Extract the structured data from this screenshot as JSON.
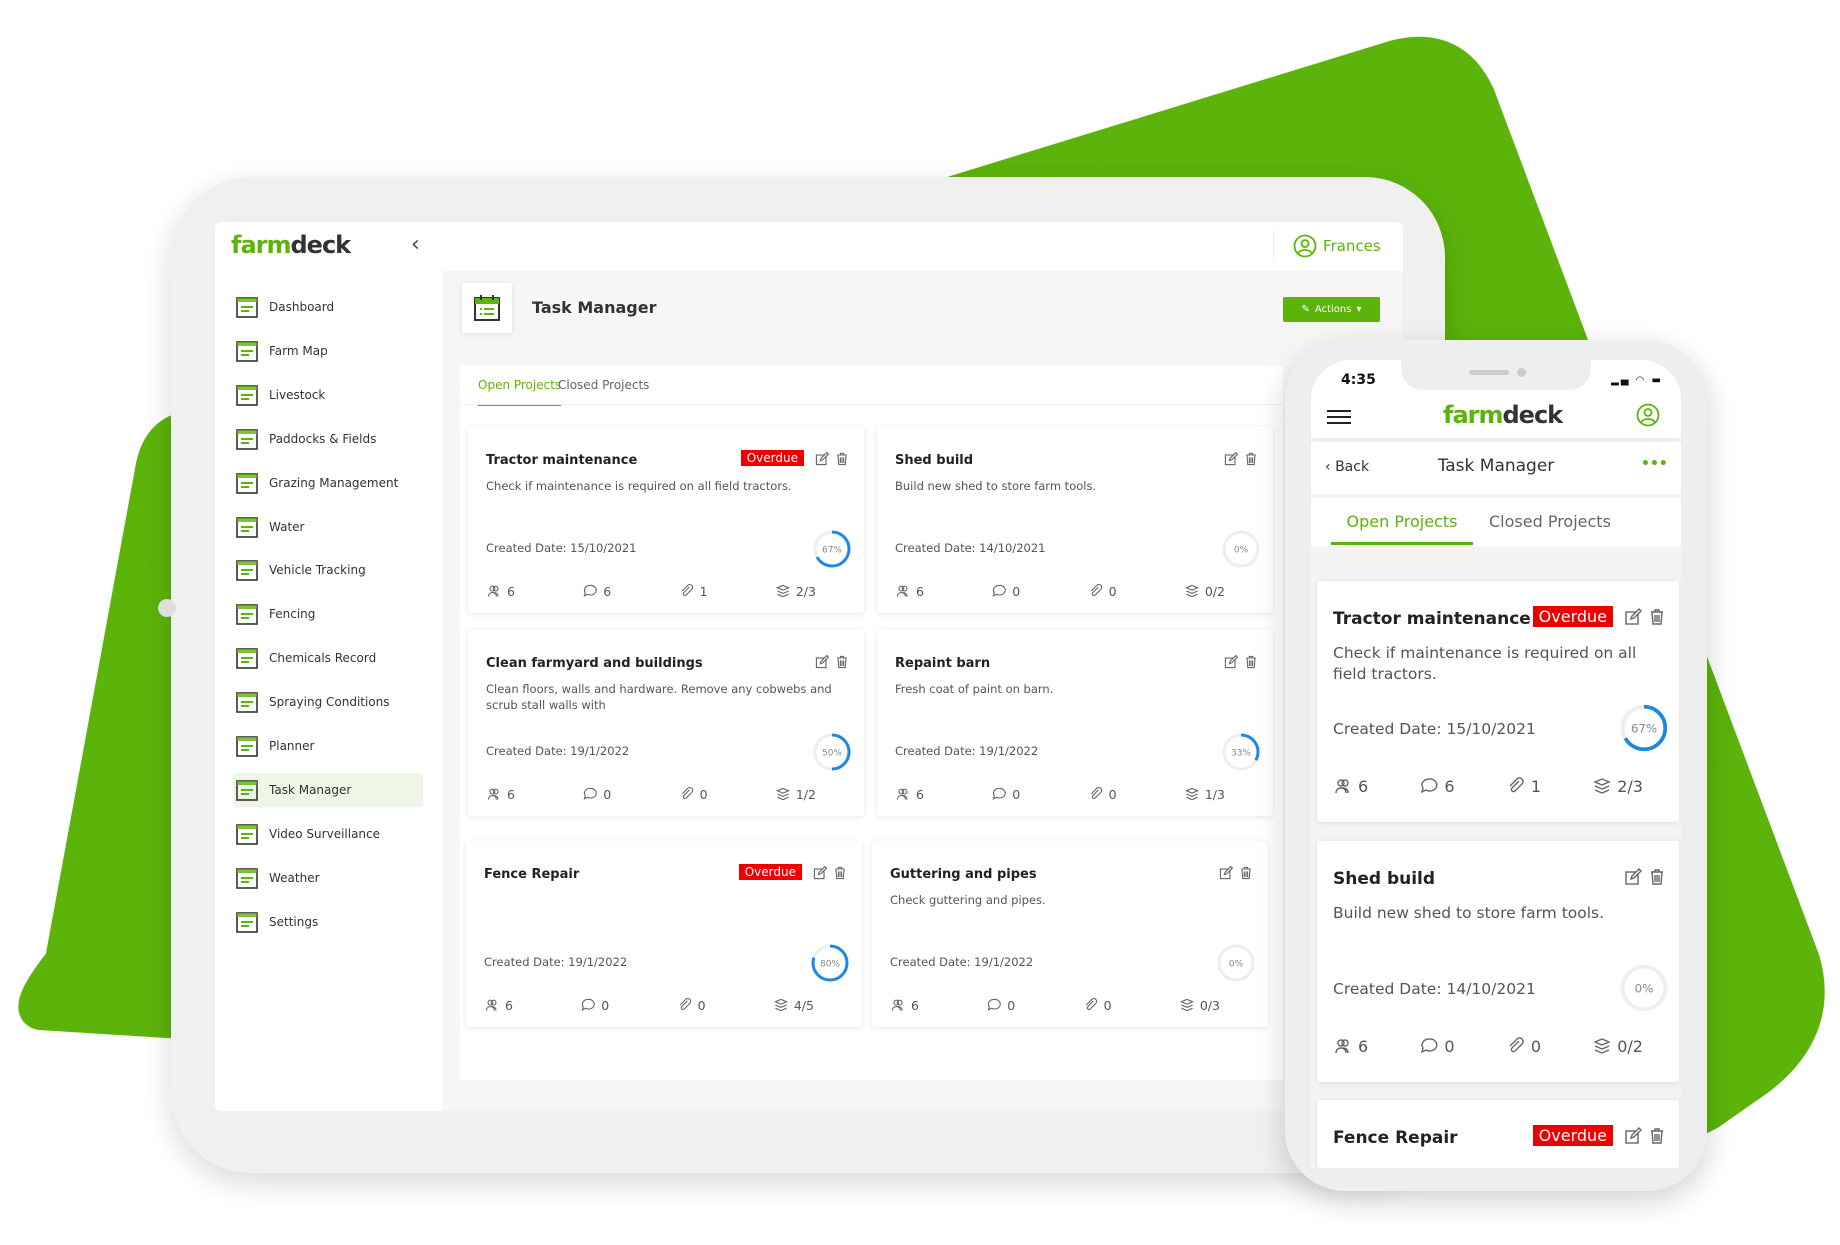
{
  "brand": {
    "logo_a": "farm",
    "logo_b": "deck",
    "green": "#5cb30a",
    "red": "#e00000",
    "ring_blue": "#1e88e5"
  },
  "tablet": {
    "user": "Frances",
    "page_title": "Task Manager",
    "actions_label": "Actions",
    "tabs": [
      {
        "label": "Open Projects",
        "active": true
      },
      {
        "label": "Closed Projects",
        "active": false
      }
    ],
    "sidebar": [
      {
        "label": "Dashboard",
        "icon": "dashboard-icon"
      },
      {
        "label": "Farm Map",
        "icon": "map-pin-icon"
      },
      {
        "label": "Livestock",
        "icon": "cow-icon"
      },
      {
        "label": "Paddocks & Fields",
        "icon": "paddock-icon"
      },
      {
        "label": "Grazing Management",
        "icon": "grass-icon"
      },
      {
        "label": "Water",
        "icon": "water-drop-icon"
      },
      {
        "label": "Vehicle Tracking",
        "icon": "vehicle-tracking-icon"
      },
      {
        "label": "Fencing",
        "icon": "fence-icon"
      },
      {
        "label": "Chemicals Record",
        "icon": "chemicals-icon"
      },
      {
        "label": "Spraying Conditions",
        "icon": "sprayer-icon"
      },
      {
        "label": "Planner",
        "icon": "planner-icon"
      },
      {
        "label": "Task Manager",
        "icon": "task-manager-icon",
        "active": true
      },
      {
        "label": "Video Surveillance",
        "icon": "camera-icon"
      },
      {
        "label": "Weather",
        "icon": "weather-icon"
      },
      {
        "label": "Settings",
        "icon": "settings-icon"
      }
    ]
  },
  "tasks": [
    {
      "title": "Tractor maintenance",
      "overdue": true,
      "description": "Check if maintenance is required on all field tractors.",
      "created": "Created Date: 15/10/2021",
      "progress": 67,
      "members": "6",
      "comments": "6",
      "attachments": "1",
      "subtasks": "2/3"
    },
    {
      "title": "Shed build",
      "overdue": false,
      "description": "Build new shed to store farm tools.",
      "created": "Created Date: 14/10/2021",
      "progress": 0,
      "members": "6",
      "comments": "0",
      "attachments": "0",
      "subtasks": "0/2"
    },
    {
      "title": "Clean farmyard and buildings",
      "overdue": false,
      "description": "Clean floors, walls and hardware. Remove any cobwebs and scrub stall walls with",
      "created": "Created Date: 19/1/2022",
      "progress": 50,
      "members": "6",
      "comments": "0",
      "attachments": "0",
      "subtasks": "1/2"
    },
    {
      "title": "Repaint barn",
      "overdue": false,
      "description": "Fresh coat of paint on barn.",
      "created": "Created Date: 19/1/2022",
      "progress": 33,
      "members": "6",
      "comments": "0",
      "attachments": "0",
      "subtasks": "1/3"
    },
    {
      "title": "Fence Repair",
      "overdue": true,
      "description": "",
      "created": "Created Date: 19/1/2022",
      "progress": 80,
      "members": "6",
      "comments": "0",
      "attachments": "0",
      "subtasks": "4/5"
    },
    {
      "title": "Guttering and pipes",
      "overdue": false,
      "description": "Check guttering and pipes.",
      "created": "Created Date: 19/1/2022",
      "progress": 0,
      "members": "6",
      "comments": "0",
      "attachments": "0",
      "subtasks": "0/3"
    }
  ],
  "overdue_label": "Overdue",
  "phone": {
    "time": "4:35",
    "back_label": "Back",
    "page_title": "Task Manager",
    "more_label": "•••",
    "tabs": [
      {
        "label": "Open Projects",
        "active": true
      },
      {
        "label": "Closed Projects",
        "active": false
      }
    ],
    "task_indices": [
      0,
      1,
      4
    ]
  }
}
